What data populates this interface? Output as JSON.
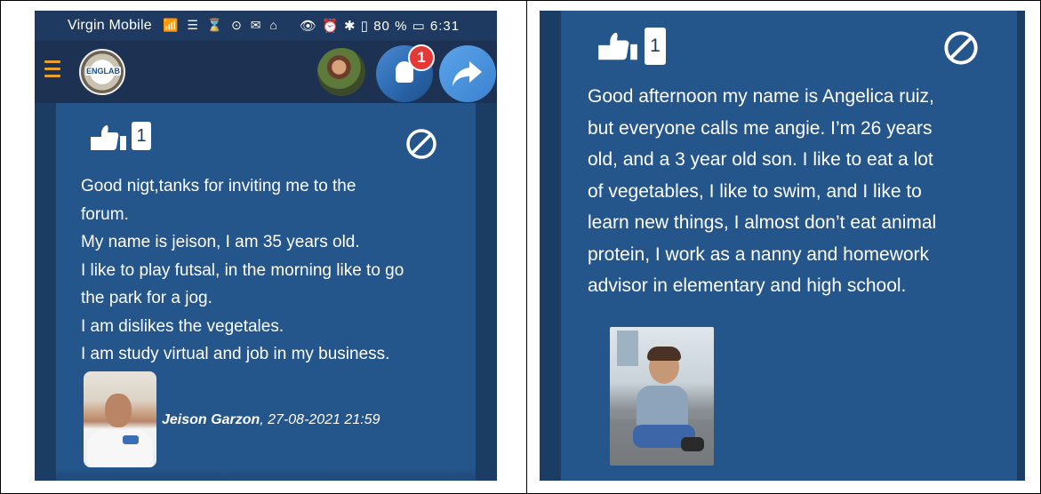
{
  "left_screen": {
    "status_bar": {
      "carrier": "Virgin Mobile",
      "system_icons": "📶 ☰ ⌛ ⊙ ✉ ⌂",
      "right_status": "👁 ⏰ ✱ ▯ 80 % ▭ 6:31"
    },
    "app_bar": {
      "logo_text": "ENGLAB",
      "notification_count": "1"
    },
    "post": {
      "like_count": "1",
      "lines": [
        "Good nigt,tanks for inviting me to the",
        "forum.",
        "My name is jeison, I am 35 years old.",
        "I like to play futsal, in the morning like to go",
        "the park for a jog.",
        "I am dislikes the vegetales.",
        "I am study virtual and job in my business."
      ],
      "author_name": "Jeison Garzon",
      "author_date": ", 27-08-2021 21:59"
    }
  },
  "right_screen": {
    "post": {
      "like_count": "1",
      "lines": [
        "Good afternoon my name is Angelica ruiz,",
        "but everyone calls me angie. I’m 26 years",
        "old, and a 3 year old son. I like to eat a lot",
        "of vegetables, I like to swim, and I like to",
        "learn new things, I almost don’t eat animal",
        "protein, I work as a nanny and homework",
        "advisor in elementary and high school."
      ]
    }
  },
  "colors": {
    "card_bg": "#24558b",
    "page_bg": "#1c3d63",
    "accent_menu": "#e6a12e",
    "badge_red": "#e53935"
  },
  "icons": [
    "menu-icon",
    "thumbs-up-icon",
    "block-icon",
    "ghost-icon",
    "share-arrow-icon"
  ]
}
